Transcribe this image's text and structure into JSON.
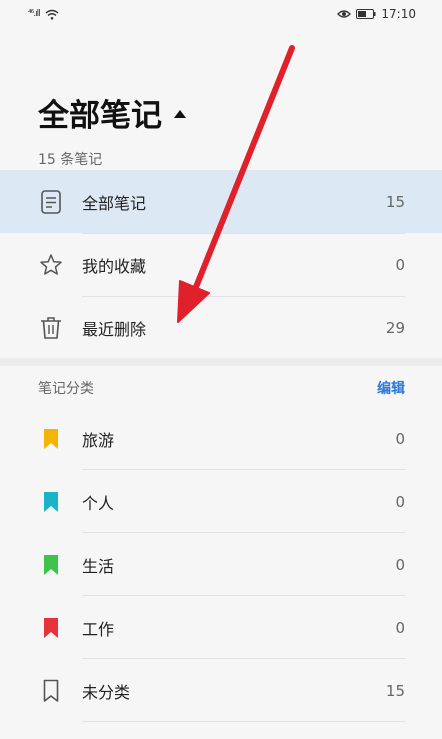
{
  "status": {
    "signal": "⁴⁶.ıll",
    "time": "17:10"
  },
  "header": {
    "title": "全部笔记",
    "subtitle": "15 条笔记"
  },
  "folders": [
    {
      "label": "全部笔记",
      "count": "15",
      "icon": "note-icon",
      "active": true
    },
    {
      "label": "我的收藏",
      "count": "0",
      "icon": "star-icon",
      "active": false
    },
    {
      "label": "最近删除",
      "count": "29",
      "icon": "trash-icon",
      "active": false
    }
  ],
  "categories": {
    "title": "笔记分类",
    "edit_label": "编辑",
    "items": [
      {
        "label": "旅游",
        "count": "0",
        "color": "#f5b400"
      },
      {
        "label": "个人",
        "count": "0",
        "color": "#1ab4c8"
      },
      {
        "label": "生活",
        "count": "0",
        "color": "#3ec24a"
      },
      {
        "label": "工作",
        "count": "0",
        "color": "#e8323a"
      },
      {
        "label": "未分类",
        "count": "15",
        "color": "outline"
      }
    ]
  },
  "colors": {
    "accent": "#2a7ad8",
    "active_row": "#dde8f5",
    "arrow": "#e0202a"
  }
}
